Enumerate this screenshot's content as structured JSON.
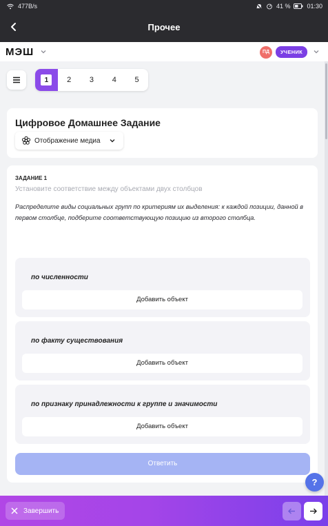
{
  "status_bar": {
    "speed": "477B/s",
    "battery": "41 %",
    "time": "01:30",
    "icons": [
      "wifi-icon",
      "mute-icon",
      "data-saver-icon",
      "battery-icon"
    ]
  },
  "app_bar": {
    "title": "Прочее",
    "back_icon": "arrow-left-icon"
  },
  "header": {
    "logo": "МЭШ",
    "avatar_initials": "ПД",
    "role": "УЧЕНИК"
  },
  "pager": {
    "pages": [
      "1",
      "2",
      "3",
      "4",
      "5"
    ],
    "active_index": 0
  },
  "assignment": {
    "title": "Цифровое Домашнее Задание",
    "media_toggle": "Отображение медиа"
  },
  "task": {
    "number": "ЗАДАНИЕ 1",
    "subtitle": "Установите соответствие между объектами двух столбцов",
    "text": "Распределите виды социальных групп по критериям их выделения: к каждой позиции, данной в первом столбце, подберите соответствующую позицию из второго столбца.",
    "criteria": [
      {
        "label": "по численности",
        "add_label": "Добавить объект"
      },
      {
        "label": "по факту существования",
        "add_label": "Добавить объект"
      },
      {
        "label": "по признаку принадлежности к группе и значимости",
        "add_label": "Добавить объект"
      }
    ],
    "answer_label": "Ответить"
  },
  "help_label": "?",
  "bottom_bar": {
    "finish_label": "Завершить"
  },
  "colors": {
    "accent_purple": "#8b4be9",
    "answer_disabled": "#a5b4f4",
    "help_blue": "#5573e8",
    "avatar_red": "#ef6f6a"
  }
}
